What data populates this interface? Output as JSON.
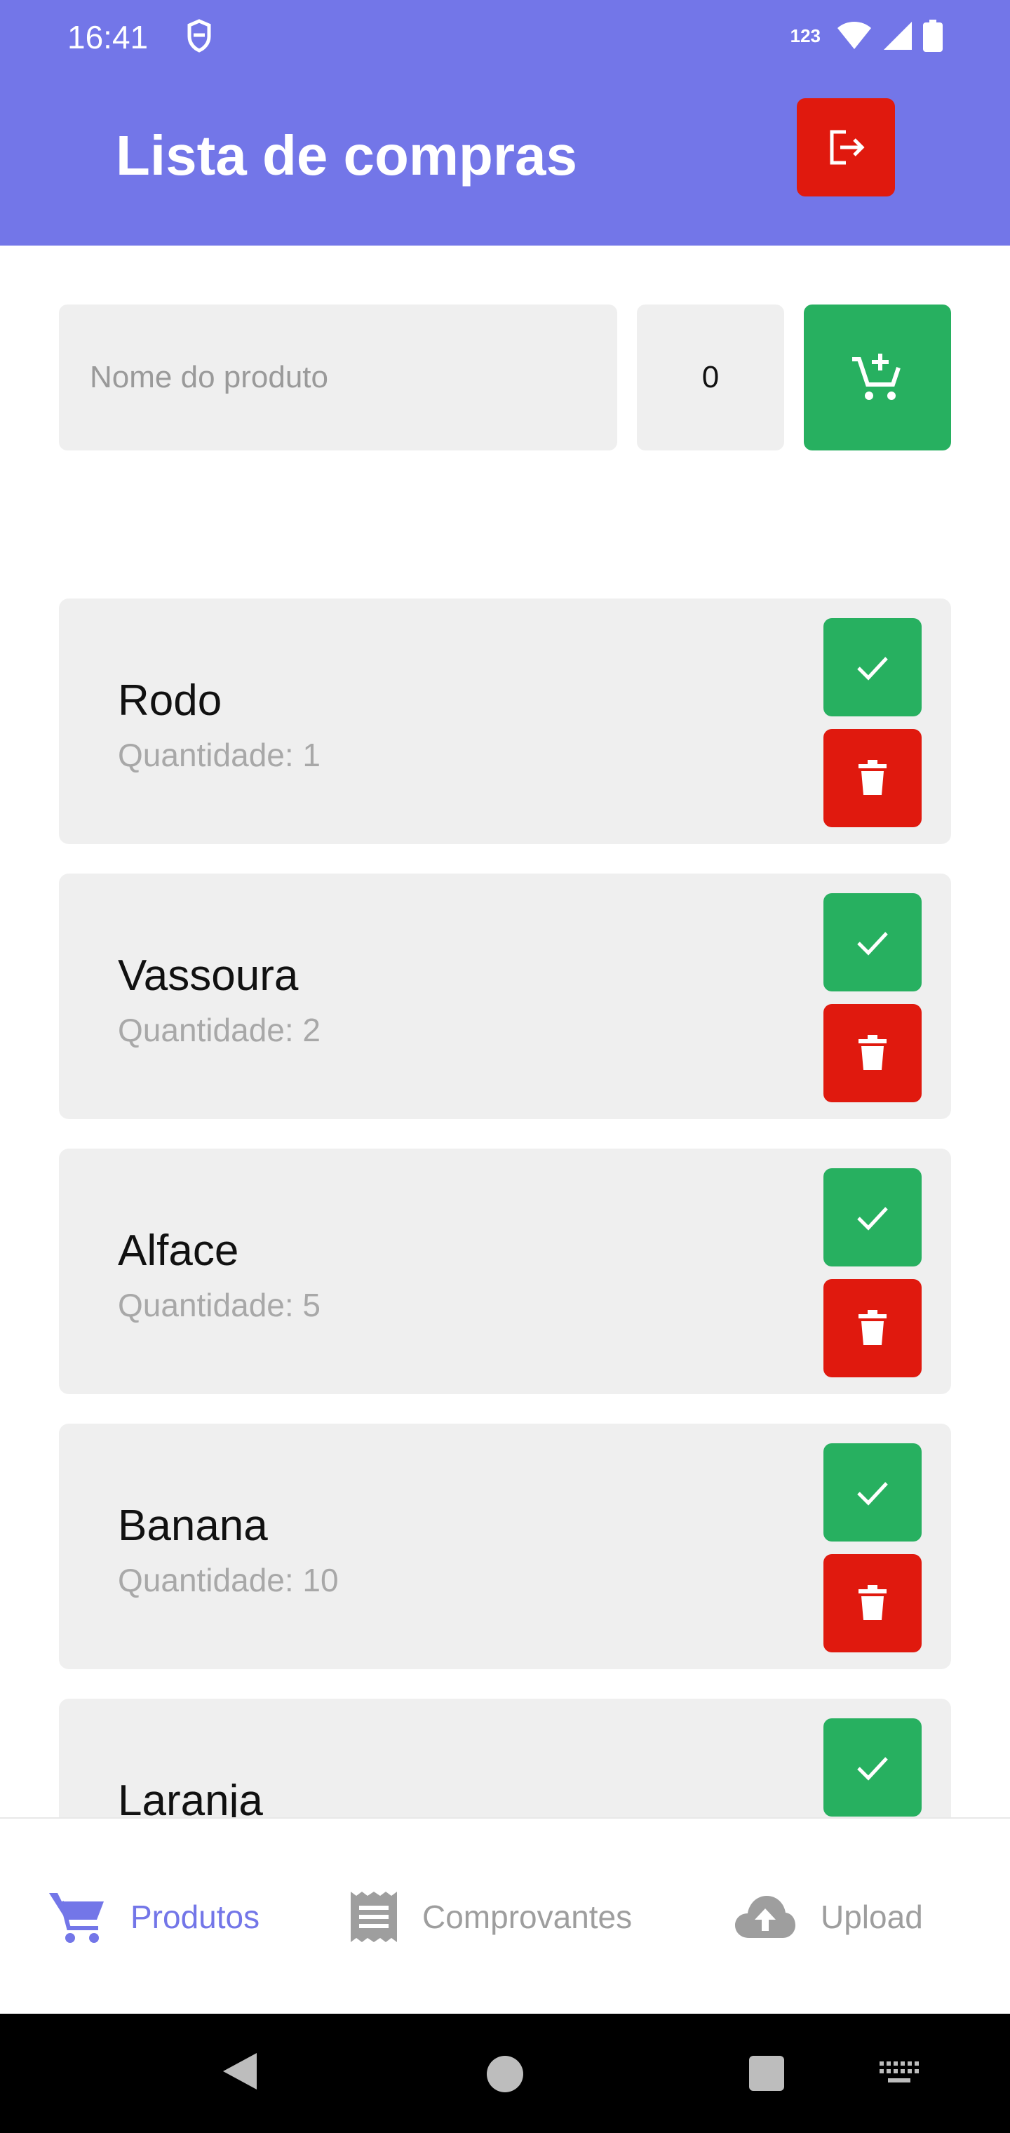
{
  "status_bar": {
    "time": "16:41",
    "network_label": "123"
  },
  "header": {
    "title": "Lista de compras",
    "logout_icon": "logout-icon"
  },
  "add_form": {
    "name_placeholder": "Nome do produto",
    "quantity_value": "0",
    "add_icon": "cart-plus-icon"
  },
  "items": [
    {
      "name": "Rodo",
      "quantity": "Quantidade: 1"
    },
    {
      "name": "Vassoura",
      "quantity": "Quantidade: 2"
    },
    {
      "name": "Alface",
      "quantity": "Quantidade: 5"
    },
    {
      "name": "Banana",
      "quantity": "Quantidade: 10"
    },
    {
      "name": "Laranja",
      "quantity": ""
    }
  ],
  "bottom_nav": {
    "tabs": [
      {
        "label": "Produtos",
        "icon": "cart-icon",
        "active": true
      },
      {
        "label": "Comprovantes",
        "icon": "receipt-icon",
        "active": false
      },
      {
        "label": "Upload",
        "icon": "cloud-upload-icon",
        "active": false
      }
    ]
  },
  "colors": {
    "primary": "#7376E8",
    "success": "#27B060",
    "danger": "#E0190E",
    "card": "#EFEFEF",
    "inactive": "#9E9E9E"
  }
}
